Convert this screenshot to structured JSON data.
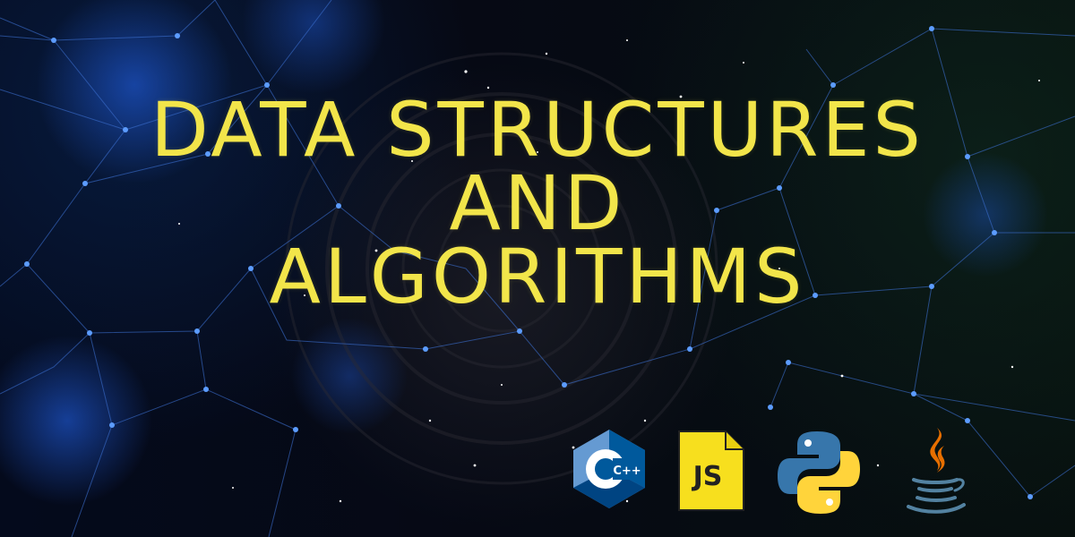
{
  "title": {
    "line1": "DATA STRUCTURES",
    "line2": "AND",
    "line3": "ALGORITHMS"
  },
  "logos": [
    {
      "icon": "cpp-logo-icon",
      "label": "C++"
    },
    {
      "icon": "javascript-logo-icon",
      "label": "JS"
    },
    {
      "icon": "python-logo-icon"
    },
    {
      "icon": "java-logo-icon"
    }
  ],
  "colors": {
    "title": "#f2e54a",
    "network_line": "#3c6fd0",
    "node": "#5c9cff",
    "cpp": "#00599c",
    "js_fill": "#f7df1e",
    "python_blue": "#3776ab",
    "python_yellow": "#ffd43b",
    "java_orange": "#e76f00",
    "java_blue": "#5382a1"
  }
}
